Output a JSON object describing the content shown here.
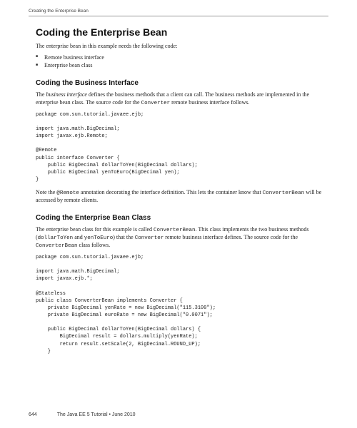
{
  "runningHead": "Creating the Enterprise Bean",
  "h1": "Coding the Enterprise Bean",
  "intro": "The enterprise bean in this example needs the following code:",
  "bullets": [
    "Remote business interface",
    "Enterprise bean class"
  ],
  "sec1": {
    "title": "Coding the Business Interface",
    "p1_a": "The ",
    "p1_em": "business interface",
    "p1_b": " defines the business methods that a client can call. The business methods are implemented in the enterprise bean class. The source code for the ",
    "p1_code": "Converter",
    "p1_c": " remote business interface follows.",
    "code": "package com.sun.tutorial.javaee.ejb;\n\nimport java.math.BigDecimal;\nimport javax.ejb.Remote;\n\n@Remote\npublic interface Converter {\n    public BigDecimal dollarToYen(BigDecimal dollars);\n    public BigDecimal yenToEuro(BigDecimal yen);\n}",
    "p2_a": "Note the ",
    "p2_code1": "@Remote",
    "p2_b": " annotation decorating the interface definition. This lets the container know that ",
    "p2_code2": "ConverterBean",
    "p2_c": " will be accessed by remote clients."
  },
  "sec2": {
    "title": "Coding the Enterprise Bean Class",
    "p1_a": "The enterprise bean class for this example is called ",
    "p1_code1": "ConverterBean",
    "p1_b": ". This class implements the two business methods (",
    "p1_code2": "dollarToYen",
    "p1_c": " and ",
    "p1_code3": "yenToEuro",
    "p1_d": ") that the ",
    "p1_code4": "Converter",
    "p1_e": " remote business interface defines. The source code for the ",
    "p1_code5": "ConverterBean",
    "p1_f": " class follows.",
    "code": "package com.sun.tutorial.javaee.ejb;\n\nimport java.math.BigDecimal;\nimport javax.ejb.*;\n\n@Stateless\npublic class ConverterBean implements Converter {\n    private BigDecimal yenRate = new BigDecimal(\"115.3100\");\n    private BigDecimal euroRate = new BigDecimal(\"0.0071\");\n\n    public BigDecimal dollarToYen(BigDecimal dollars) {\n        BigDecimal result = dollars.multiply(yenRate);\n        return result.setScale(2, BigDecimal.ROUND_UP);\n    }"
  },
  "footer": {
    "page": "644",
    "book": "The Java EE 5 Tutorial  •  June 2010"
  }
}
